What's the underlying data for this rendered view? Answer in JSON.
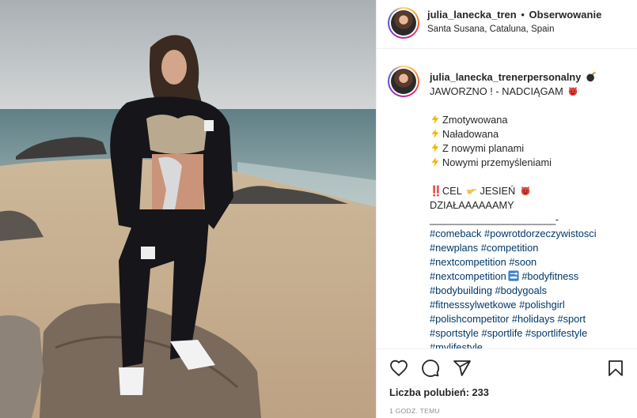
{
  "post": {
    "author": {
      "username": "julia_lanecka_tren",
      "separator": "•",
      "follow_label": "Obserwowanie",
      "location": "Santa Susana, Cataluna, Spain"
    },
    "caption": {
      "username": "julia_lanecka_trenerpersonalny",
      "lines": [
        "JAWORZNO ! - NADCIĄGAM",
        "Zmotywowana",
        "Naładowana",
        "Z nowymi planami",
        "Nowymi przemyśleniami",
        "‼️CEL",
        "JESIEŃ",
        "DZIAŁAAAAAAMY",
        "________________________-"
      ],
      "hashtags": [
        [
          "#comeback",
          "#powrotdorzeczywistosci"
        ],
        [
          "#newplans",
          "#competition"
        ],
        [
          "#nextcompetition",
          "#soon"
        ],
        [
          "#nextcompetition",
          "#bodyfitness"
        ],
        [
          "#bodybuilding",
          "#bodygoals"
        ],
        [
          "#fitnesssylwetkowe",
          "#polishgirl"
        ],
        [
          "#polishcompetitor",
          "#holidays",
          "#sport"
        ],
        [
          "#sportstyle",
          "#sportlife",
          "#sportlifestyle"
        ],
        [
          "#mylifestyle"
        ]
      ]
    },
    "likes": "Liczba polubień: 233",
    "time": "1 GODZ. TEMU",
    "icons": {
      "like": "heart-icon",
      "comment": "comment-icon",
      "share": "share-icon",
      "save": "bookmark-icon",
      "bomb": "bomb-emoji",
      "devil": "devil-emoji",
      "bolt": "lightning-emoji",
      "point": "pointing-hand-emoji",
      "soon": "soon-arrow-emoji"
    },
    "colors": {
      "link": "#00376b",
      "text": "#262626",
      "muted": "#8e8e8e"
    }
  }
}
